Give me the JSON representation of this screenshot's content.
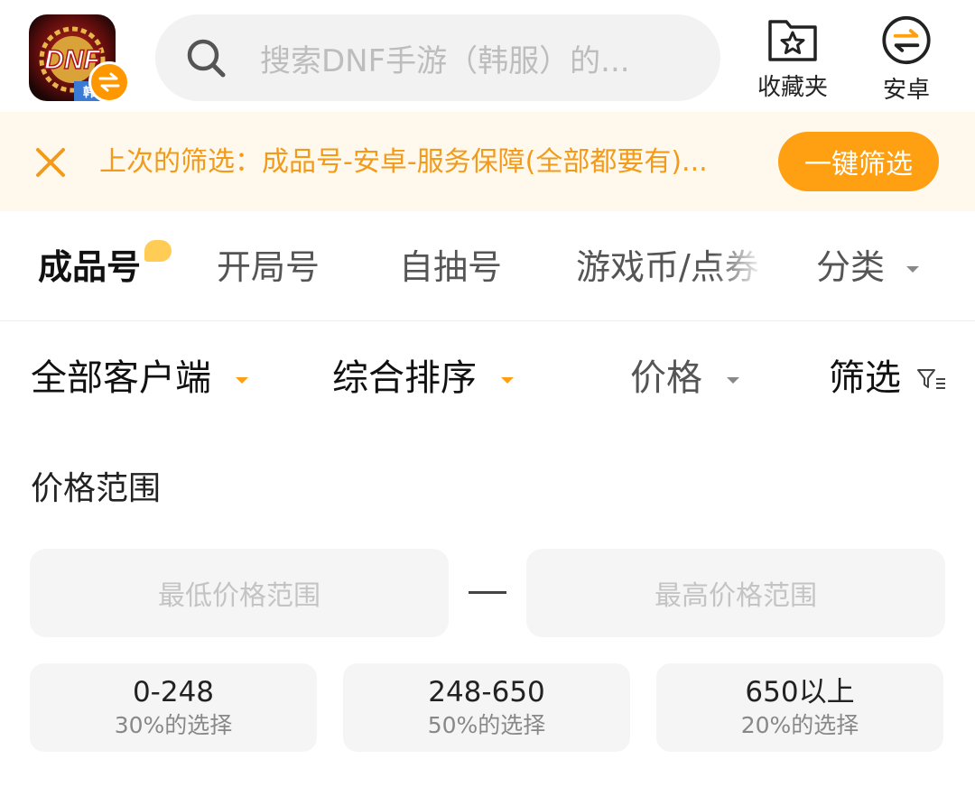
{
  "header": {
    "app_icon_text": "DNF",
    "app_icon_sub": "韩",
    "search_placeholder": "搜索DNF手游（韩服）的...",
    "favorites_label": "收藏夹",
    "platform_label": "安卓"
  },
  "banner": {
    "text": "上次的筛选：成品号-安卓-服务保障(全部都要有)...",
    "button_label": "一键筛选"
  },
  "tabs": [
    {
      "label": "成品号",
      "active": true
    },
    {
      "label": "开局号"
    },
    {
      "label": "自抽号"
    },
    {
      "label": "游戏币/点券"
    },
    {
      "label": "分类"
    }
  ],
  "filters": {
    "client": "全部客户端",
    "sort": "综合排序",
    "price": "价格",
    "filter": "筛选"
  },
  "price_range": {
    "title": "价格范围",
    "min_placeholder": "最低价格范围",
    "max_placeholder": "最高价格范围",
    "options": [
      {
        "range": "0-248",
        "share": "30%的选择"
      },
      {
        "range": "248-650",
        "share": "50%的选择"
      },
      {
        "range": "650以上",
        "share": "20%的选择"
      }
    ]
  },
  "colors": {
    "accent": "#ff9f12",
    "banner_bg": "#fff8ec",
    "banner_text": "#f29a1a"
  }
}
